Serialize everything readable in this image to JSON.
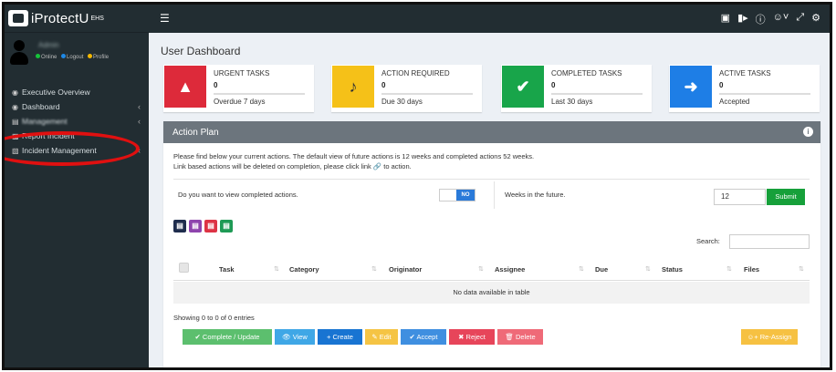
{
  "app": {
    "logo_text": "iProtectU",
    "logo_sup": "EHS"
  },
  "user": {
    "name": "Admin",
    "status_items": [
      {
        "label": "Online",
        "color": "#16c23a"
      },
      {
        "label": "Logout",
        "color": "#1e88e5"
      },
      {
        "label": "Profile",
        "color": "#f5b800"
      }
    ]
  },
  "sidebar": {
    "items": [
      {
        "label": "Executive Overview",
        "icon": "dashboard-icon",
        "chevron": false
      },
      {
        "label": "Dashboard",
        "icon": "dashboard-icon",
        "chevron": true
      },
      {
        "label": "Management",
        "icon": "sitemap-icon",
        "chevron": true
      },
      {
        "label": "Report Incident",
        "icon": "report-icon",
        "chevron": false
      },
      {
        "label": "Incident Management",
        "icon": "folder-icon",
        "chevron": true
      }
    ]
  },
  "topbar": {
    "icons": [
      "briefcase-icon",
      "video-icon",
      "info-icon",
      "user-icon",
      "expand-icon",
      "cogs-icon"
    ]
  },
  "page": {
    "title": "User Dashboard"
  },
  "info_boxes": [
    {
      "title": "URGENT TASKS",
      "value": "0",
      "desc": "Overdue 7 days",
      "color": "#dd2a3a",
      "icon": "warning-icon"
    },
    {
      "title": "ACTION REQUIRED",
      "value": "0",
      "desc": "Due 30 days",
      "color": "#f5c118",
      "icon": "bell-icon"
    },
    {
      "title": "COMPLETED TASKS",
      "value": "0",
      "desc": "Last 30 days",
      "color": "#18a54a",
      "icon": "check-icon"
    },
    {
      "title": "ACTIVE TASKS",
      "value": "0",
      "desc": "Accepted",
      "color": "#1e7ee6",
      "icon": "bolt-icon"
    }
  ],
  "action_plan": {
    "title": "Action Plan",
    "desc_line1": "Please find below your current actions. The default view of future actions is 12 weeks and completed actions 52 weeks.",
    "desc_line2": "Link based actions will be deleted on completion, please click link 🔗 to action.",
    "completed_question": "Do you want to view completed actions.",
    "toggle_value": "NO",
    "weeks_label": "Weeks in the future.",
    "weeks_value": "12",
    "submit_label": "Submit",
    "export_buttons": [
      {
        "name": "export-copy-button",
        "color": "#1f2d4d",
        "glyph": "⎘"
      },
      {
        "name": "export-csv-button",
        "color": "#8e44ad",
        "glyph": "⎙"
      },
      {
        "name": "export-pdf-button",
        "color": "#dd3344",
        "glyph": "▤"
      },
      {
        "name": "export-excel-button",
        "color": "#1e9a55",
        "glyph": "▦"
      }
    ],
    "search_label": "Search:",
    "columns": [
      "Task",
      "Category",
      "Originator",
      "Assignee",
      "Due",
      "Status",
      "Files"
    ],
    "empty_text": "No data available in table",
    "showing_text": "Showing 0 to 0 of 0 entries",
    "buttons": [
      {
        "label": "✔ Complete / Update",
        "color": "#5cbf6e",
        "name": "complete-update-button"
      },
      {
        "label": "👁 View",
        "color": "#3fa7e6",
        "name": "view-button"
      },
      {
        "label": "+ Create",
        "color": "#1874d2",
        "name": "create-button"
      },
      {
        "label": "✎ Edit",
        "color": "#f5c444",
        "name": "edit-button"
      },
      {
        "label": "✔ Accept",
        "color": "#3f8fe0",
        "name": "accept-button"
      },
      {
        "label": "✖ Reject",
        "color": "#e7455a",
        "name": "reject-button"
      },
      {
        "label": "🗑 Delete",
        "color": "#ef6a78",
        "name": "delete-button"
      }
    ],
    "reassign_label": "Re-Assign"
  }
}
